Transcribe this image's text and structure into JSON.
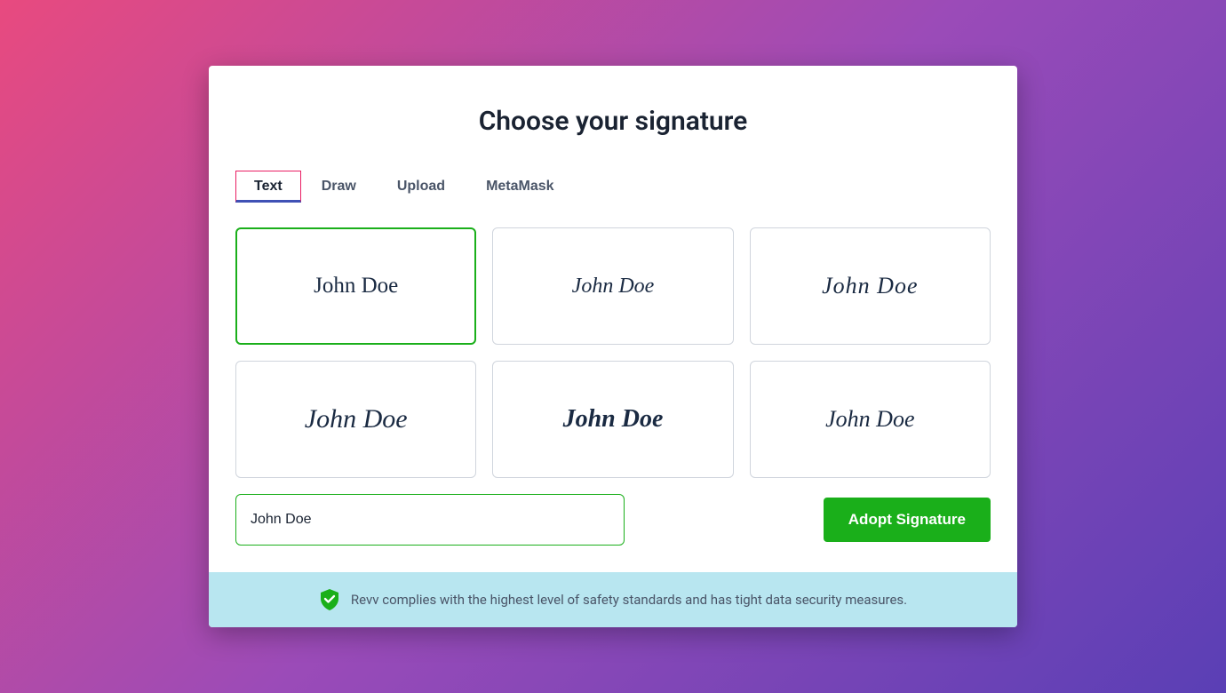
{
  "title": "Choose your signature",
  "tabs": {
    "text": "Text",
    "draw": "Draw",
    "upload": "Upload",
    "metamask": "MetaMask"
  },
  "signatures": {
    "card1": "John Doe",
    "card2": "John Doe",
    "card3": "John Doe",
    "card4": "John Doe",
    "card5": "John Doe",
    "card6": "John Doe"
  },
  "input": {
    "value": "John Doe"
  },
  "adopt_button": "Adopt Signature",
  "footer": {
    "text": "Revv complies with the highest level of safety standards and has tight data security measures."
  }
}
